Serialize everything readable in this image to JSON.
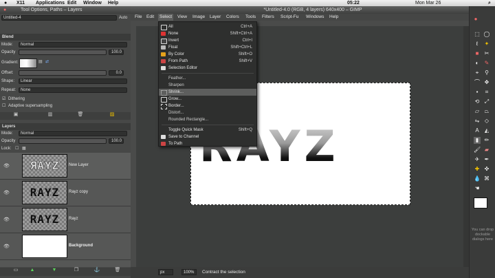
{
  "macbar": {
    "apple": "",
    "items": [
      "X11",
      "Applications",
      "Edit",
      "Window",
      "Help"
    ],
    "clock": "05:22",
    "date": "Mon Mar 26"
  },
  "tool_options": {
    "title": "Tool Options, Paths – Layers",
    "image_select": "Untitled-4",
    "auto_label": "Auto",
    "section": "Blend",
    "mode_label": "Mode:",
    "mode_value": "Normal",
    "opacity_label": "Opacity",
    "opacity_value": "100.0",
    "gradient_label": "Gradient:",
    "offset_label": "Offset:",
    "offset_value": "0.0",
    "shape_label": "Shape:",
    "shape_value": "Linear",
    "repeat_label": "Repeat:",
    "repeat_value": "None",
    "dithering_label": "Dithering",
    "adaptive_label": "Adaptive supersampling"
  },
  "layers": {
    "section": "Layers",
    "mode_label": "Mode:",
    "mode_value": "Normal",
    "opacity_label": "Opacity",
    "opacity_value": "100.0",
    "lock_label": "Lock:",
    "items": [
      {
        "name": "New Layer",
        "thumb_text": "ЯAYZ"
      },
      {
        "name": "Rayz copy",
        "thumb_text": "RAYZ"
      },
      {
        "name": "Rayz",
        "thumb_text": "RAYZ"
      },
      {
        "name": "Background",
        "thumb_text": ""
      }
    ]
  },
  "window": {
    "title": "*Untitled-4.0 (RGB, 4 layers) 640x400 – GIMP",
    "menu": [
      "File",
      "Edit",
      "Select",
      "View",
      "Image",
      "Layer",
      "Colors",
      "Tools",
      "Filters",
      "Script-Fu",
      "Windows",
      "Help"
    ]
  },
  "canvas_text": "RAYZ",
  "select_menu": {
    "items": [
      {
        "label": "All",
        "shortcut": "Ctrl+A"
      },
      {
        "label": "None",
        "shortcut": "Shift+Ctrl+A"
      },
      {
        "label": "Invert",
        "shortcut": "Ctrl+I"
      },
      {
        "label": "Float",
        "shortcut": "Shift+Ctrl+L"
      },
      {
        "label": "By Color",
        "shortcut": "Shift+O"
      },
      {
        "label": "From Path",
        "shortcut": "Shift+V"
      },
      {
        "label": "Selection Editor",
        "shortcut": ""
      },
      {
        "label": "Feather...",
        "shortcut": ""
      },
      {
        "label": "Sharpen",
        "shortcut": ""
      },
      {
        "label": "Shrink...",
        "shortcut": ""
      },
      {
        "label": "Grow...",
        "shortcut": ""
      },
      {
        "label": "Border...",
        "shortcut": ""
      },
      {
        "label": "Distort...",
        "shortcut": ""
      },
      {
        "label": "Rounded Rectangle...",
        "shortcut": ""
      },
      {
        "label": "Toggle Quick Mask",
        "shortcut": "Shift+Q"
      },
      {
        "label": "Save to Channel",
        "shortcut": ""
      },
      {
        "label": "To Path",
        "shortcut": ""
      }
    ]
  },
  "status": {
    "unit": "px",
    "zoom": "100%",
    "message": "Contract the selection"
  },
  "toolbox": {
    "drop_hint": "You can drop dockable dialogs here"
  },
  "colors": {
    "highlight": "#5d5e5d",
    "menu_bg": "#2e2f2e",
    "canvas_bg": "#3c3e3d"
  }
}
